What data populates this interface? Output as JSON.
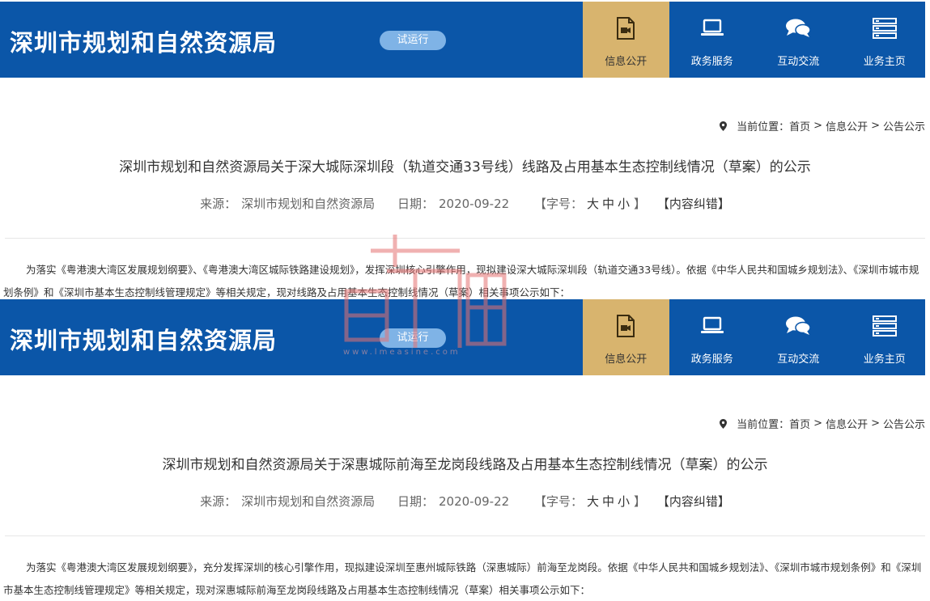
{
  "header": {
    "site_name": "深圳市规划和自然资源局",
    "beta_badge": "试运行",
    "nav": [
      {
        "label": "信息公开",
        "icon": "video-document-icon",
        "active": true
      },
      {
        "label": "政务服务",
        "icon": "laptop-icon",
        "active": false
      },
      {
        "label": "互动交流",
        "icon": "chat-bubbles-icon",
        "active": false
      },
      {
        "label": "业务主页",
        "icon": "server-stack-icon",
        "active": false
      }
    ]
  },
  "breadcrumb": {
    "prefix": "当前位置：",
    "items": [
      "首页",
      "信息公开",
      "公告公示"
    ],
    "separator": ">"
  },
  "meta_labels": {
    "source": "来源：",
    "date": "日期：",
    "font_size": "【字号：",
    "large": "大",
    "medium": "中",
    "small": "小",
    "close": "】",
    "error_report": "【内容纠错】"
  },
  "articles": [
    {
      "title": "深圳市规划和自然资源局关于深大城际深圳段（轨道交通33号线）线路及占用基本生态控制线情况（草案）的公示",
      "source": "深圳市规划和自然资源局",
      "date": "2020-09-22",
      "body": "为落实《粤港澳大湾区发展规划纲要》、《粤港澳大湾区城际铁路建设规划》，发挥深圳核心引擎作用，现拟建设深大城际深圳段（轨道交通33号线）。依据《中华人民共和国城乡规划法》、《深圳市城市规划条例》和《深圳市基本生态控制线管理规定》等相关规定，现对线路及占用基本生态控制线情况（草案）相关事项公示如下："
    },
    {
      "title": "深圳市规划和自然资源局关于深惠城际前海至龙岗段线路及占用基本生态控制线情况（草案）的公示",
      "source": "深圳市规划和自然资源局",
      "date": "2020-09-22",
      "body": "为落实《粤港澳大湾区发展规划纲要》，充分发挥深圳的核心引擎作用，现拟建设深圳至惠州城际铁路（深惠城际）前海至龙岗段。依据《中华人民共和国城乡规划法》、《深圳市城市规划条例》和《深圳市基本生态控制线管理规定》等相关规定，现对深惠城际前海至龙岗段线路及占用基本生态控制线情况（草案）相关事项公示如下："
    }
  ],
  "watermark": {
    "url": "www.lmeasine.com"
  },
  "colors": {
    "header_bg": "#0b56a8",
    "nav_active_bg": "#d8b46e",
    "badge_bg": "#7fb3e6"
  }
}
